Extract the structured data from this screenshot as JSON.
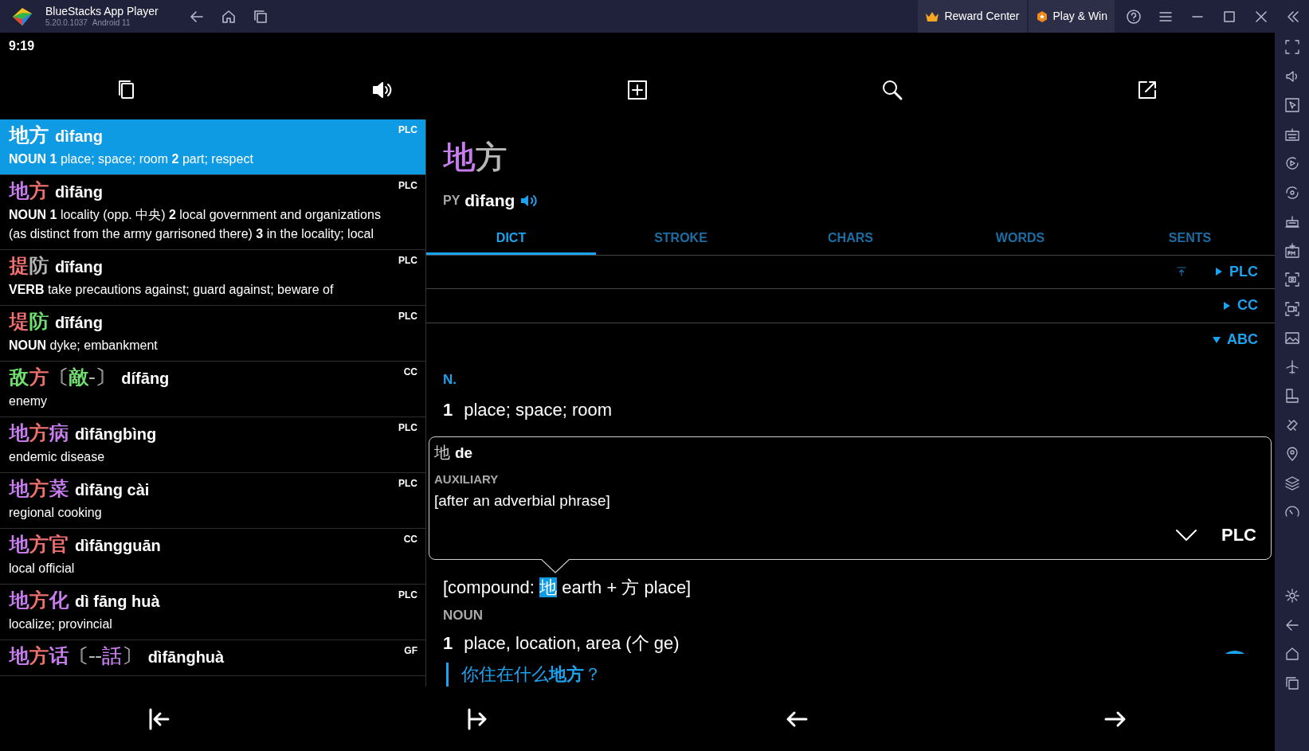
{
  "window": {
    "title": "BlueStacks App Player",
    "version": "5.20.0.1037",
    "android": "Android 11",
    "buttons": [
      "Reward Center",
      "Play & Win"
    ]
  },
  "status_bar": {
    "time": "9:19"
  },
  "results": [
    {
      "chars": [
        {
          "t": "地",
          "color": "#ffffff"
        },
        {
          "t": "方",
          "color": "#ffffff"
        }
      ],
      "pinyin": "dìfang",
      "definition": "**NOUN** **1** place; space; room **2** part; respect",
      "source": "PLC",
      "selected": true
    },
    {
      "chars": [
        {
          "t": "地",
          "color": "#c77dee"
        },
        {
          "t": "方",
          "color": "#f07070"
        }
      ],
      "pinyin": "dìfāng",
      "definition": "**NOUN** **1** locality (opp. 中央) **2** local government and organizations (as distinct from the army garrisoned there) **3** in the locality; local",
      "source": "PLC",
      "selected": false
    },
    {
      "chars": [
        {
          "t": "提",
          "color": "#f07070"
        },
        {
          "t": "防",
          "color": "#b8b8b8"
        }
      ],
      "pinyin": "dīfang",
      "definition": "**VERB** take precautions against; guard against; beware of",
      "source": "PLC",
      "selected": false
    },
    {
      "chars": [
        {
          "t": "堤",
          "color": "#f07070"
        },
        {
          "t": "防",
          "color": "#70e070"
        }
      ],
      "pinyin": "dīfáng",
      "definition": "**NOUN** dyke; embankment",
      "source": "PLC",
      "selected": false
    },
    {
      "chars": [
        {
          "t": "敌",
          "color": "#70e070"
        },
        {
          "t": "方",
          "color": "#f07070"
        },
        {
          "t": "〔",
          "color": "#b8b8b8"
        },
        {
          "t": "敵",
          "color": "#70e070"
        },
        {
          "t": "-〕",
          "color": "#b8b8b8"
        }
      ],
      "pinyin": "dífāng",
      "definition": "enemy",
      "source": "CC",
      "selected": false
    },
    {
      "chars": [
        {
          "t": "地",
          "color": "#c77dee"
        },
        {
          "t": "方",
          "color": "#f07070"
        },
        {
          "t": "病",
          "color": "#c77dee"
        }
      ],
      "pinyin": "dìfāngbìng",
      "definition": "endemic disease",
      "source": "PLC",
      "selected": false
    },
    {
      "chars": [
        {
          "t": "地",
          "color": "#c77dee"
        },
        {
          "t": "方",
          "color": "#f07070"
        },
        {
          "t": "菜",
          "color": "#c77dee"
        }
      ],
      "pinyin": "dìfāng cài",
      "definition": "regional cooking",
      "source": "PLC",
      "selected": false
    },
    {
      "chars": [
        {
          "t": "地",
          "color": "#c77dee"
        },
        {
          "t": "方",
          "color": "#f07070"
        },
        {
          "t": "官",
          "color": "#f07070"
        }
      ],
      "pinyin": "dìfāngguān",
      "definition": "local official",
      "source": "CC",
      "selected": false
    },
    {
      "chars": [
        {
          "t": "地",
          "color": "#c77dee"
        },
        {
          "t": "方",
          "color": "#f07070"
        },
        {
          "t": "化",
          "color": "#c77dee"
        }
      ],
      "pinyin": "dì fāng huà",
      "definition": "localize; provincial",
      "source": "PLC",
      "selected": false
    },
    {
      "chars": [
        {
          "t": "地",
          "color": "#c77dee"
        },
        {
          "t": "方",
          "color": "#f07070"
        },
        {
          "t": "话",
          "color": "#c77dee"
        },
        {
          "t": "〔--",
          "color": "#b8b8b8"
        },
        {
          "t": "話",
          "color": "#c77dee"
        },
        {
          "t": "〕",
          "color": "#b8b8b8"
        }
      ],
      "pinyin": "dìfānghuà",
      "source": "GF",
      "selected": false
    }
  ],
  "detail": {
    "headword": [
      {
        "t": "地",
        "color": "#c77dee"
      },
      {
        "t": "方",
        "color": "#b8b8b8"
      }
    ],
    "py_label": "PY",
    "pinyin": "dìfang",
    "tabs": [
      {
        "label": "DICT",
        "selected": true
      },
      {
        "label": "STROKE",
        "selected": false
      },
      {
        "label": "CHARS",
        "selected": false
      },
      {
        "label": "WORDS",
        "selected": false
      },
      {
        "label": "SENTS",
        "selected": false
      }
    ],
    "sections": [
      {
        "label": "PLC",
        "expanded": false
      },
      {
        "label": "CC",
        "expanded": false
      },
      {
        "label": "ABC",
        "expanded": true
      }
    ],
    "abc": {
      "pos": "N.",
      "senses": [
        {
          "num": "1",
          "text": "place; space; room"
        }
      ]
    },
    "popup": {
      "char": "地",
      "pinyin": "de",
      "pos": "AUXILIARY",
      "definition": "[after an adverbial phrase]",
      "source": "PLC"
    },
    "etymology": {
      "before": "[compound: ",
      "highlight": "地",
      "after": " earth + 方 place]"
    },
    "pos": "NOUN",
    "senses": [
      {
        "num": "1",
        "text": "place, location, area (个 ge)"
      }
    ],
    "example": "你住在什么**地方**？"
  }
}
